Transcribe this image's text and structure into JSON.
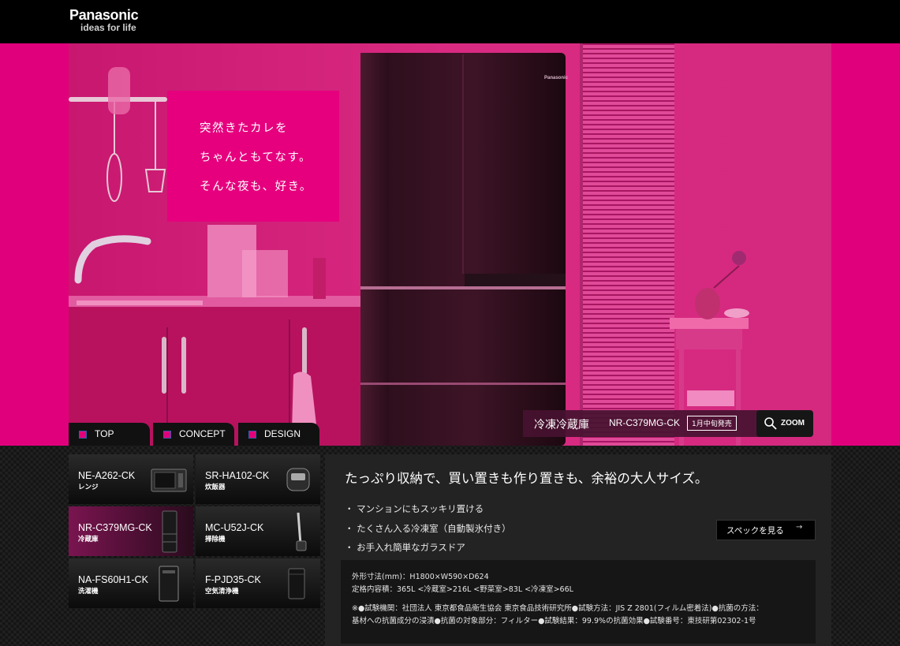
{
  "header": {
    "brand": "Panasonic",
    "tagline": "ideas for life"
  },
  "hero": {
    "tagline_lines": [
      "突然きたカレを",
      "ちゃんともてなす。",
      "そんな夜も、好き。"
    ],
    "fridge_logo": "Panasonic",
    "product_category": "冷凍冷蔵庫",
    "product_model": "NR-C379MG-CK",
    "release_badge": "1月中旬発売",
    "zoom_label": "ZOOM",
    "tabs": [
      {
        "label": "TOP"
      },
      {
        "label": "CONCEPT"
      },
      {
        "label": "DESIGN"
      }
    ],
    "colors": {
      "accent": "#e1007c",
      "tab_marker_border": "#3a5aa6"
    }
  },
  "products": [
    {
      "model": "NE-A262-CK",
      "category": "レンジ",
      "icon": "microwave-icon"
    },
    {
      "model": "SR-HA102-CK",
      "category": "炊飯器",
      "icon": "rice-cooker-icon"
    },
    {
      "model": "NR-C379MG-CK",
      "category": "冷蔵庫",
      "icon": "refrigerator-icon"
    },
    {
      "model": "MC-U52J-CK",
      "category": "掃除機",
      "icon": "vacuum-icon"
    },
    {
      "model": "NA-FS60H1-CK",
      "category": "洗濯機",
      "icon": "washing-machine-icon"
    },
    {
      "model": "F-PJD35-CK",
      "category": "空気清浄機",
      "icon": "air-purifier-icon"
    }
  ],
  "detail": {
    "headline": "たっぷり収納で、買い置きも作り置きも、余裕の大人サイズ。",
    "features": [
      "・ マンションにもスッキリ置ける",
      "・ たくさん入る冷凍室（自動製氷付き）",
      "・ お手入れ簡単なガラスドア"
    ],
    "spec_button_label": "スペックを見る",
    "spec_button_arrow": "→",
    "dimensions": "外形寸法(mm)：H1800×W590×D624",
    "capacity": "定格内容積：365L <冷蔵室>216L <野菜室>83L <冷凍室>66L",
    "note_line1": "※●試験機関：社団法人 東京都食品衛生協会 東京食品技術研究所●試験方法：JIS Z 2801(フィルム密着法)●抗菌の方法：",
    "note_line2": "基材への抗菌成分の浸漬●抗菌の対象部分：フィルター●試験結果：99.9%の抗菌効果●試験番号：東技研第02302-1号"
  }
}
